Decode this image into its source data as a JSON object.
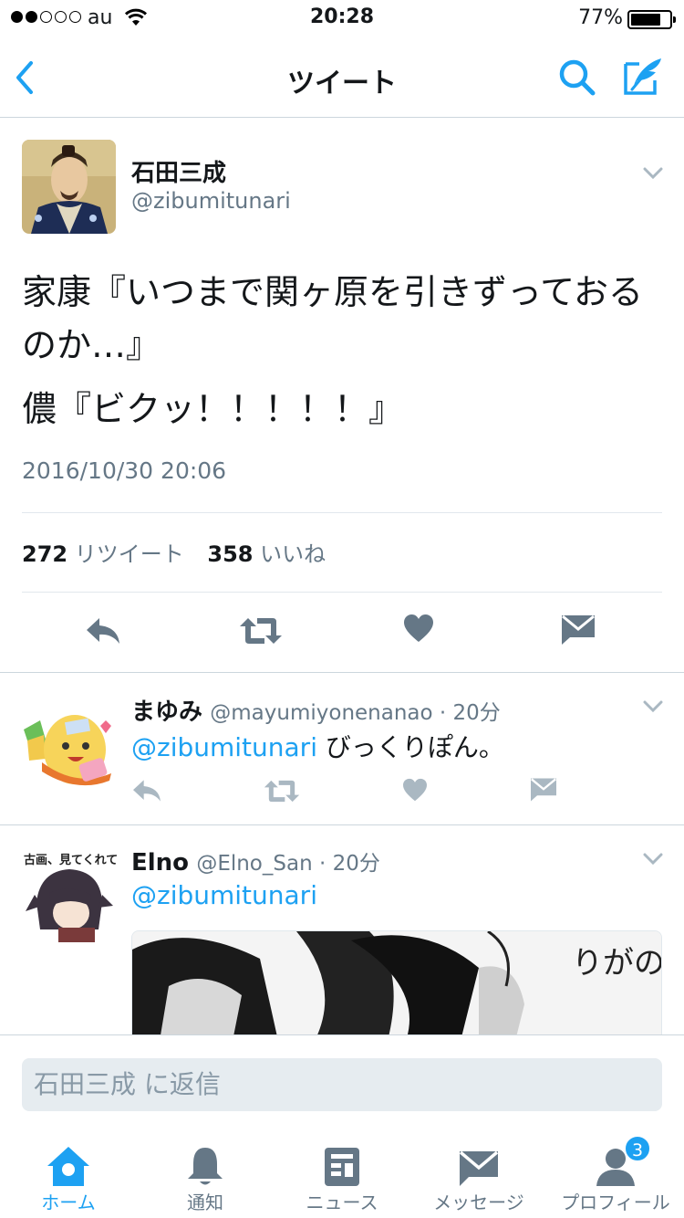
{
  "status_bar": {
    "carrier": "au",
    "time": "20:28",
    "battery_percent": "77%",
    "battery_level": 0.77
  },
  "nav": {
    "title": "ツイート"
  },
  "tweet": {
    "author_name": "石田三成",
    "author_handle": "@zibumitunari",
    "body_line1": "家康『いつまで関ヶ原を引きずっておるのか…』",
    "body_line2": "儂『ビクッ！！！！！』",
    "date": "2016/10/30 20:06",
    "retweet_count": "272",
    "retweet_label": "リツイート",
    "like_count": "358",
    "like_label": "いいね"
  },
  "replies": [
    {
      "name": "まゆみ",
      "handle_time": "@mayumiyonenanao · 20分",
      "mention": "@zibumitunari",
      "text": " びっくりぽん。"
    },
    {
      "name": "Elno",
      "handle_time": "@Elno_San · 20分",
      "mention": "@zibumitunari",
      "text": "",
      "avatar_caption": "古画、見てくれてた?!",
      "media_text": "りがの"
    }
  ],
  "reply_bar": {
    "placeholder": "石田三成 に返信"
  },
  "tabbar": {
    "home": "ホーム",
    "notifications": "通知",
    "news": "ニュース",
    "messages": "メッセージ",
    "profile": "プロフィール",
    "profile_badge": "3"
  },
  "colors": {
    "accent": "#1da1f2",
    "secondary_text": "#657786",
    "icon_gray": "#657786"
  }
}
